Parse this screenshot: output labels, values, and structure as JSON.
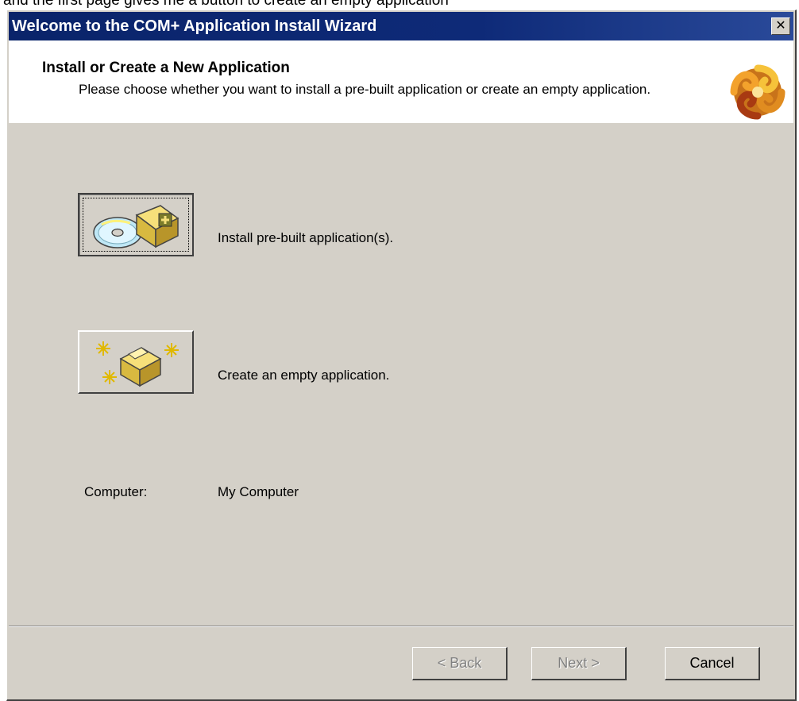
{
  "caption_fragment": "and the first page gives me a button to create an empty application",
  "window": {
    "title": "Welcome to the COM+ Application Install Wizard",
    "close_glyph": "✕"
  },
  "header": {
    "title": "Install or Create a New Application",
    "description": "Please choose whether you want to install a pre-built application or create an empty application.",
    "logo_icon": "complus-spiral-logo"
  },
  "options": [
    {
      "label": "Install pre-built application(s).",
      "icon": "install-package-cd-icon",
      "pressed": true
    },
    {
      "label": "Create an empty application.",
      "icon": "new-package-sparkle-icon",
      "pressed": false
    }
  ],
  "computer": {
    "label": "Computer:",
    "value": "My Computer"
  },
  "buttons": {
    "back": "< Back",
    "next": "Next >",
    "cancel": "Cancel"
  },
  "colors": {
    "titlebar": "#0a246a",
    "dialog_bg": "#d4d0c8"
  }
}
